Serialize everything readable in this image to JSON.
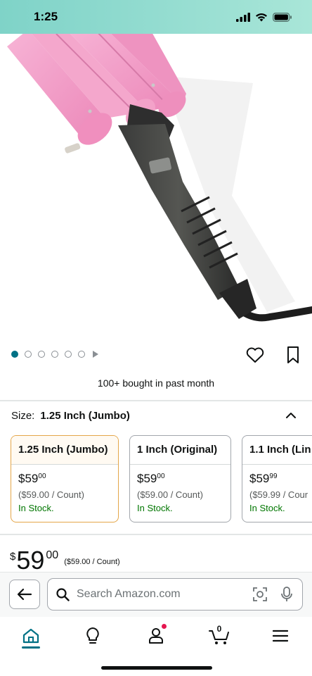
{
  "status": {
    "time": "1:25"
  },
  "product": {
    "image_alt": "Pink three-barrel hair waver curling iron with black handle and cord",
    "carousel": {
      "total_dots": 6,
      "active_index": 0,
      "has_video": true
    },
    "bought_text": "100+ bought in past month"
  },
  "size": {
    "label": "Size:",
    "selected": "1.25 Inch (Jumbo)",
    "options": [
      {
        "name": "1.25 Inch (Jumbo)",
        "price_symbol": "$",
        "price_whole": "59",
        "price_fraction": "00",
        "unit_price": "($59.00 / Count)",
        "stock": "In Stock.",
        "selected": true
      },
      {
        "name": "1 Inch (Original)",
        "price_symbol": "$",
        "price_whole": "59",
        "price_fraction": "00",
        "unit_price": "($59.00 / Count)",
        "stock": "In Stock.",
        "selected": false
      },
      {
        "name": "1.1 Inch (Lin",
        "price_symbol": "$",
        "price_whole": "59",
        "price_fraction": "99",
        "unit_price": "($59.99 / Cour",
        "stock": "In Stock.",
        "selected": false
      }
    ]
  },
  "price": {
    "symbol": "$",
    "whole": "59",
    "fraction": "00",
    "unit": "($59.00 / Count)"
  },
  "search": {
    "placeholder": "Search Amazon.com"
  },
  "nav": {
    "items": [
      "home-icon",
      "lightbulb-icon",
      "account-icon",
      "cart-icon",
      "menu-icon"
    ],
    "cart_count": "0",
    "active": "home"
  },
  "colors": {
    "accent_teal": "#007185",
    "selected_border": "#e4a649",
    "in_stock": "#007600",
    "product_pink": "#f19ac3",
    "notification": "#e5154f"
  }
}
